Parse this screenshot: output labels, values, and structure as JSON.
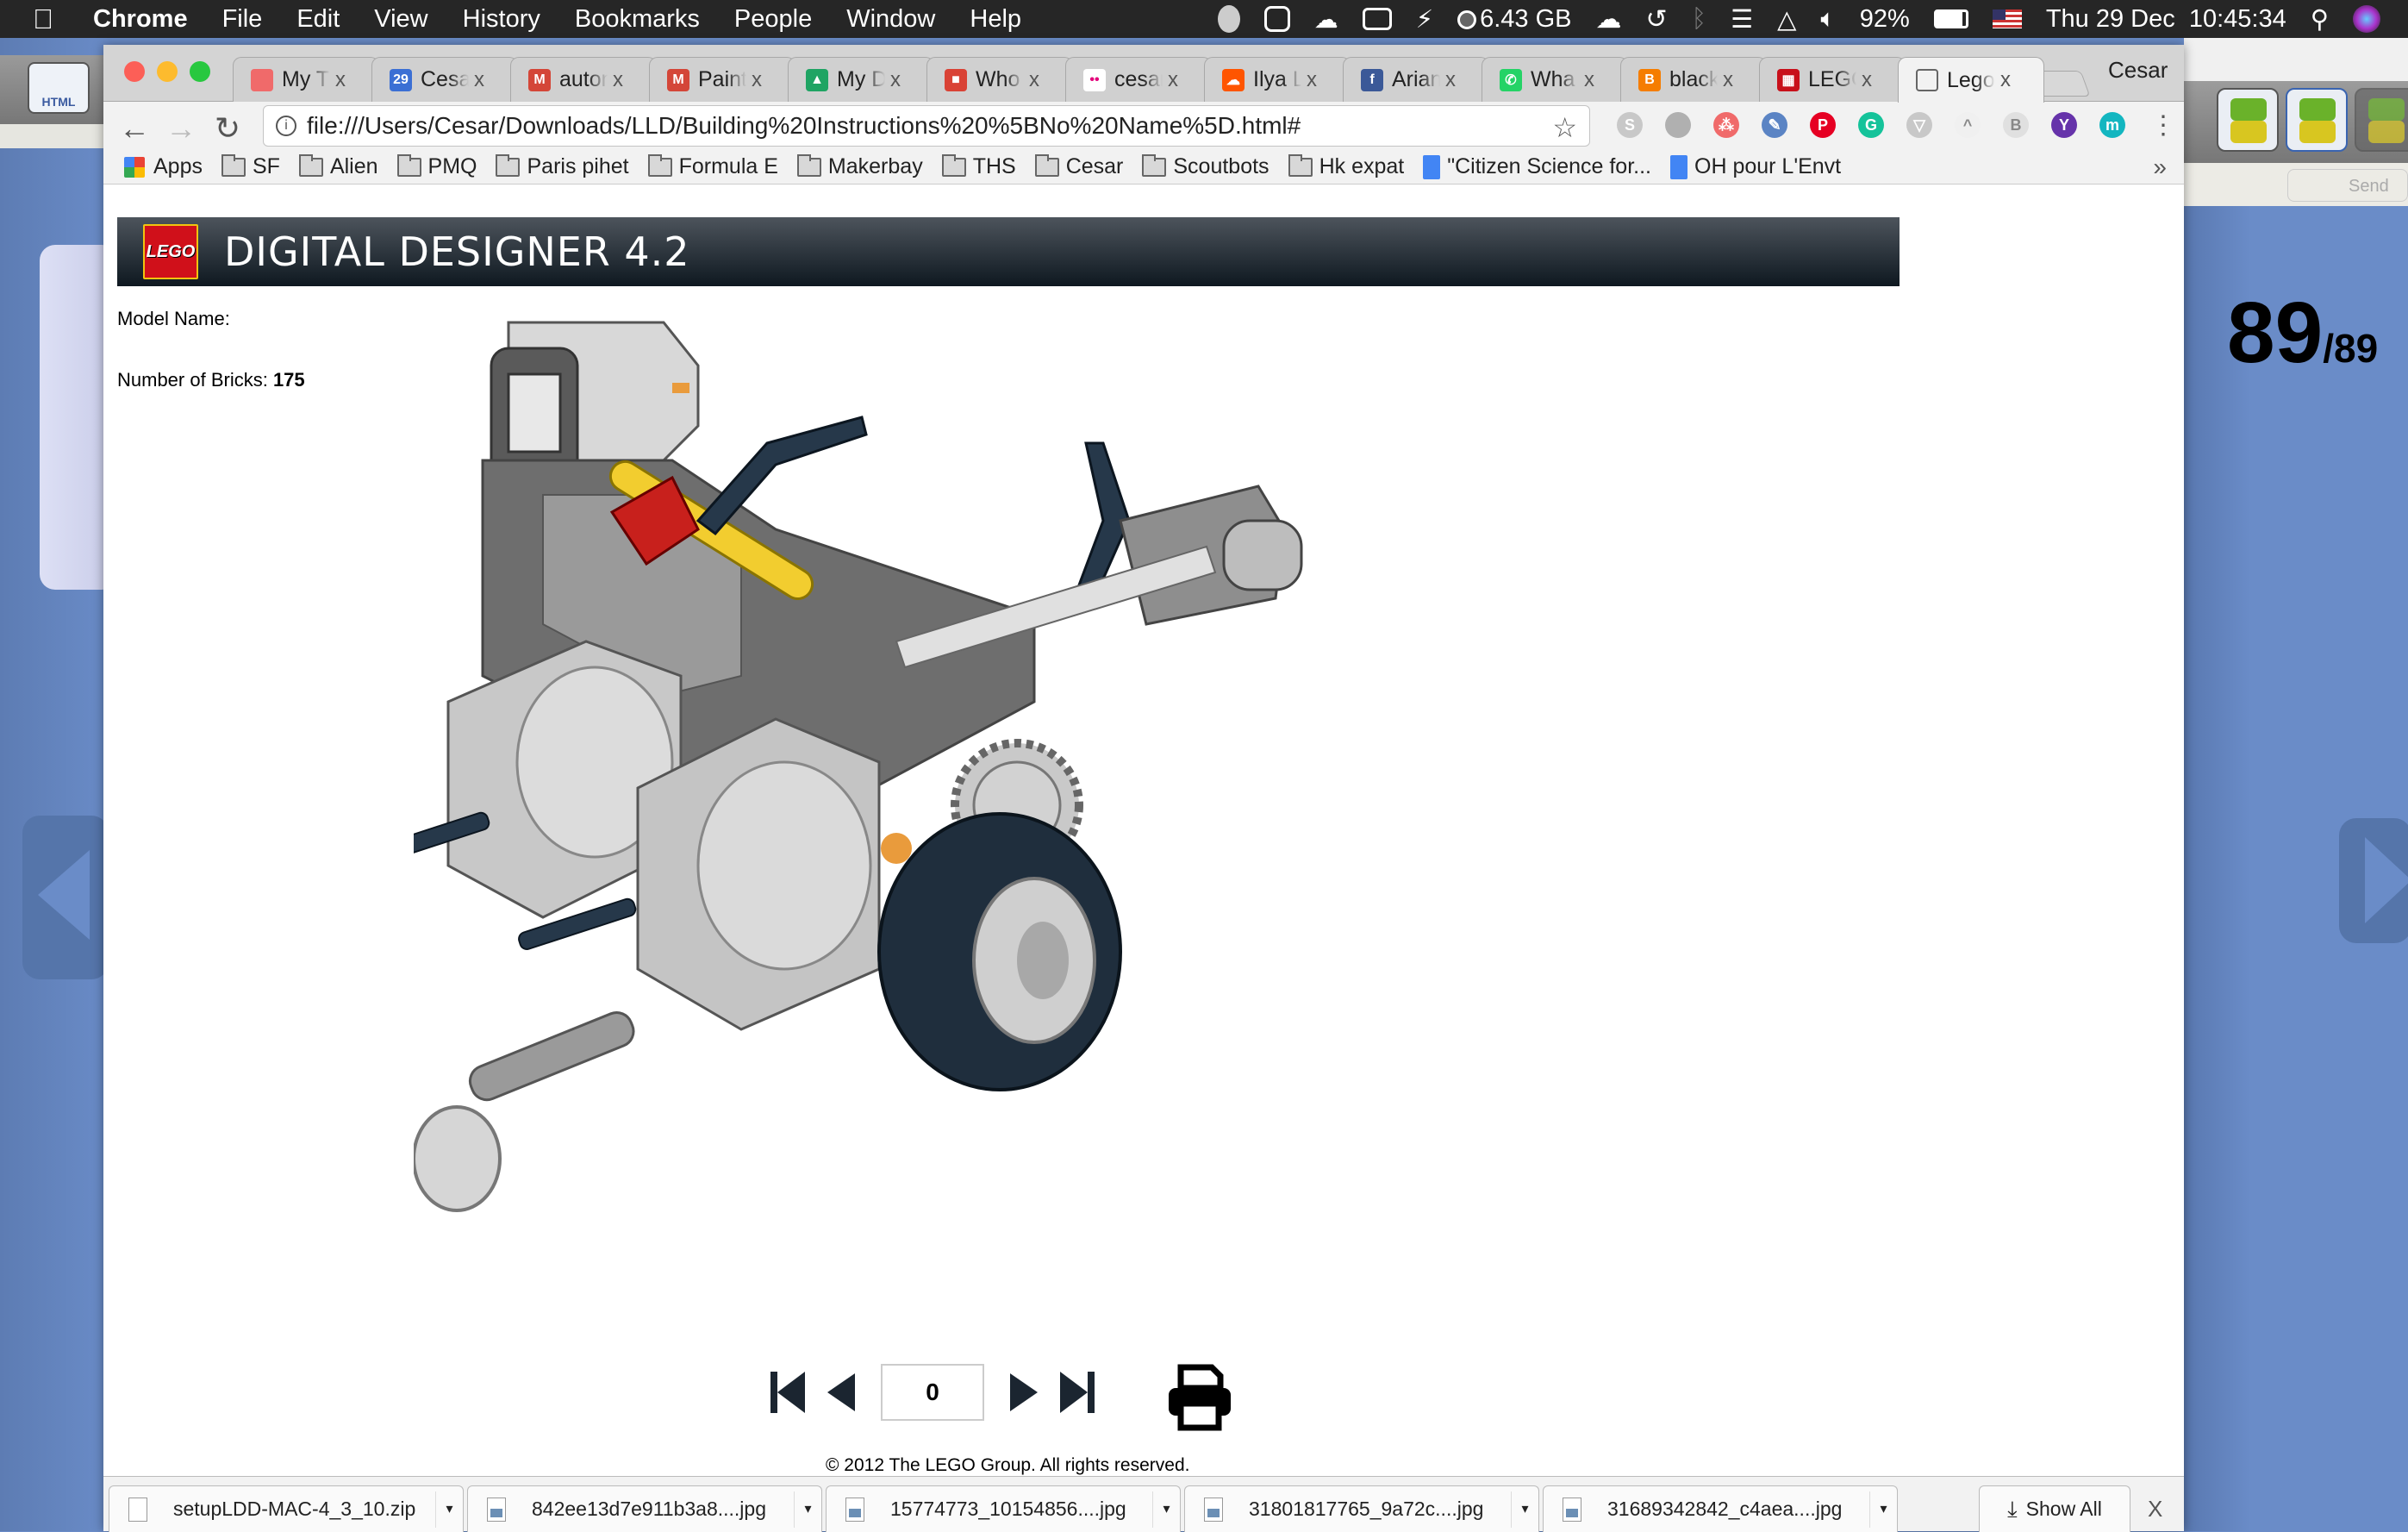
{
  "menubar": {
    "apple": "",
    "items": [
      "Chrome",
      "File",
      "Edit",
      "View",
      "History",
      "Bookmarks",
      "People",
      "Window",
      "Help"
    ],
    "status": {
      "memory": "6.43 GB",
      "battery": "92%",
      "datetime": "Thu 29 Dec  10:45:34"
    }
  },
  "ldd_app": {
    "html_button_label": "HTML",
    "send_label": "Send",
    "step_counter": "89",
    "step_total": "/89"
  },
  "browser": {
    "tabs": [
      {
        "title": "My T",
        "favicon": "asana",
        "color": "#f06a6a"
      },
      {
        "title": "Cesar",
        "favicon": "calendar",
        "color": "#3b6fd4",
        "glyph": "29"
      },
      {
        "title": "autom",
        "favicon": "gmail",
        "color": "#d44638",
        "glyph": "M"
      },
      {
        "title": "Paint",
        "favicon": "gmail",
        "color": "#d44638",
        "glyph": "M"
      },
      {
        "title": "My D",
        "favicon": "drive",
        "color": "#1fa463",
        "glyph": "▲"
      },
      {
        "title": "Who",
        "favicon": "app",
        "color": "#d94235",
        "glyph": "■"
      },
      {
        "title": "cesar",
        "favicon": "flickr",
        "color": "#ffffff",
        "glyph": "••"
      },
      {
        "title": "Ilya L",
        "favicon": "soundcloud",
        "color": "#ff5500",
        "glyph": "☁"
      },
      {
        "title": "Arian",
        "favicon": "facebook",
        "color": "#3b5998",
        "glyph": "f"
      },
      {
        "title": "Wha",
        "favicon": "whatsapp",
        "color": "#25d366",
        "glyph": "✆"
      },
      {
        "title": "black",
        "favicon": "blogger",
        "color": "#f57d00",
        "glyph": "B"
      },
      {
        "title": "LEGO",
        "favicon": "lego",
        "color": "#c8101a",
        "glyph": "▦"
      },
      {
        "title": "Lego",
        "favicon": "page",
        "color": "#ffffff",
        "glyph": "",
        "active": true
      }
    ],
    "tab_close": "x",
    "profile_name": "Cesar",
    "url": "file:///Users/Cesar/Downloads/LLD/Building%20Instructions%20%5BNo%20Name%5D.html#",
    "extensions": [
      {
        "name": "skype",
        "color": "#c8c8c8",
        "glyph": "S"
      },
      {
        "name": "bubble",
        "color": "#b0b0b0",
        "glyph": ""
      },
      {
        "name": "asana",
        "color": "#f06a6a",
        "glyph": "⁂"
      },
      {
        "name": "eyedropper",
        "color": "#5b84c4",
        "glyph": "✎"
      },
      {
        "name": "pinterest",
        "color": "#e60023",
        "glyph": "P"
      },
      {
        "name": "grammarly",
        "color": "#15c39a",
        "glyph": "G"
      },
      {
        "name": "filter",
        "color": "#c8c8c8",
        "glyph": "▽"
      },
      {
        "name": "arc",
        "color": "#f0f0f0",
        "glyph": "^"
      },
      {
        "name": "bookmark-ext",
        "color": "#e0e0e0",
        "glyph": "B"
      },
      {
        "name": "yahoo",
        "color": "#6633aa",
        "glyph": "Y"
      },
      {
        "name": "m-ext",
        "color": "#13b6c0",
        "glyph": "m"
      }
    ],
    "bookmarks": [
      {
        "label": "Apps",
        "type": "apps"
      },
      {
        "label": "SF",
        "type": "folder"
      },
      {
        "label": "Alien",
        "type": "folder"
      },
      {
        "label": "PMQ",
        "type": "folder"
      },
      {
        "label": "Paris pihet",
        "type": "folder"
      },
      {
        "label": "Formula E",
        "type": "folder"
      },
      {
        "label": "Makerbay",
        "type": "folder"
      },
      {
        "label": "THS",
        "type": "folder"
      },
      {
        "label": "Cesar",
        "type": "folder"
      },
      {
        "label": "Scoutbots",
        "type": "folder"
      },
      {
        "label": "Hk expat",
        "type": "folder"
      },
      {
        "label": "\"Citizen Science for...",
        "type": "doc"
      },
      {
        "label": "OH pour L'Envt",
        "type": "doc"
      }
    ],
    "bookmarks_overflow": "»"
  },
  "page": {
    "header_title": "DIGITAL DESIGNER 4.2",
    "logo_text": "LEGO",
    "model_name_label": "Model Name:",
    "model_name_value": "",
    "bricks_label": "Number of Bricks: ",
    "bricks_value": "175",
    "step_value": "0",
    "copyright": "© 2012 The LEGO Group. All rights reserved."
  },
  "downloads": {
    "items": [
      {
        "name": "setupLDD-MAC-4_3_10.zip",
        "type": "zip"
      },
      {
        "name": "842ee13d7e911b3a8....jpg",
        "type": "img"
      },
      {
        "name": "15774773_10154856....jpg",
        "type": "img"
      },
      {
        "name": "31801817765_9a72c....jpg",
        "type": "img"
      },
      {
        "name": "31689342842_c4aea....jpg",
        "type": "img"
      }
    ],
    "show_all": "Show All",
    "close": "X"
  }
}
